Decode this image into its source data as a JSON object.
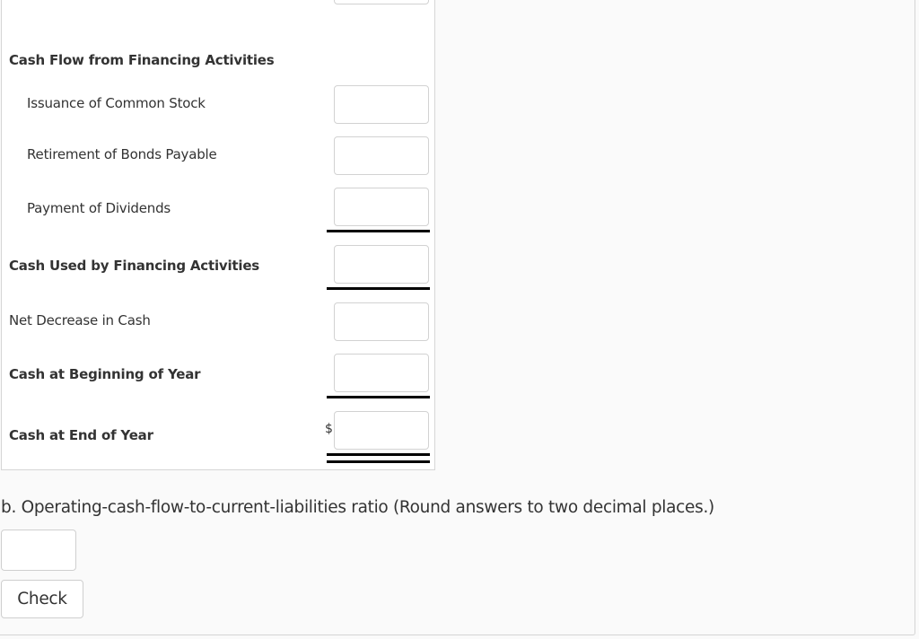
{
  "statement": {
    "section_heading": "Cash Flow from Financing Activities",
    "rows": [
      {
        "label": "Issuance of Common Stock",
        "value": ""
      },
      {
        "label": "Retirement of Bonds Payable",
        "value": ""
      },
      {
        "label": "Payment of Dividends",
        "value": ""
      }
    ],
    "subtotal": {
      "label": "Cash Used by Financing Activities",
      "value": ""
    },
    "net_change": {
      "label": "Net Decrease in Cash",
      "value": ""
    },
    "beginning": {
      "label": "Cash at Beginning of Year",
      "value": ""
    },
    "ending": {
      "label": "Cash at End of Year",
      "value": "",
      "currency_symbol": "$"
    },
    "top_partial_field_value": ""
  },
  "part_b": {
    "question": "b. Operating-cash-flow-to-current-liabilities ratio (Round answers to two decimal places.)",
    "answer_value": "",
    "check_label": "Check"
  }
}
